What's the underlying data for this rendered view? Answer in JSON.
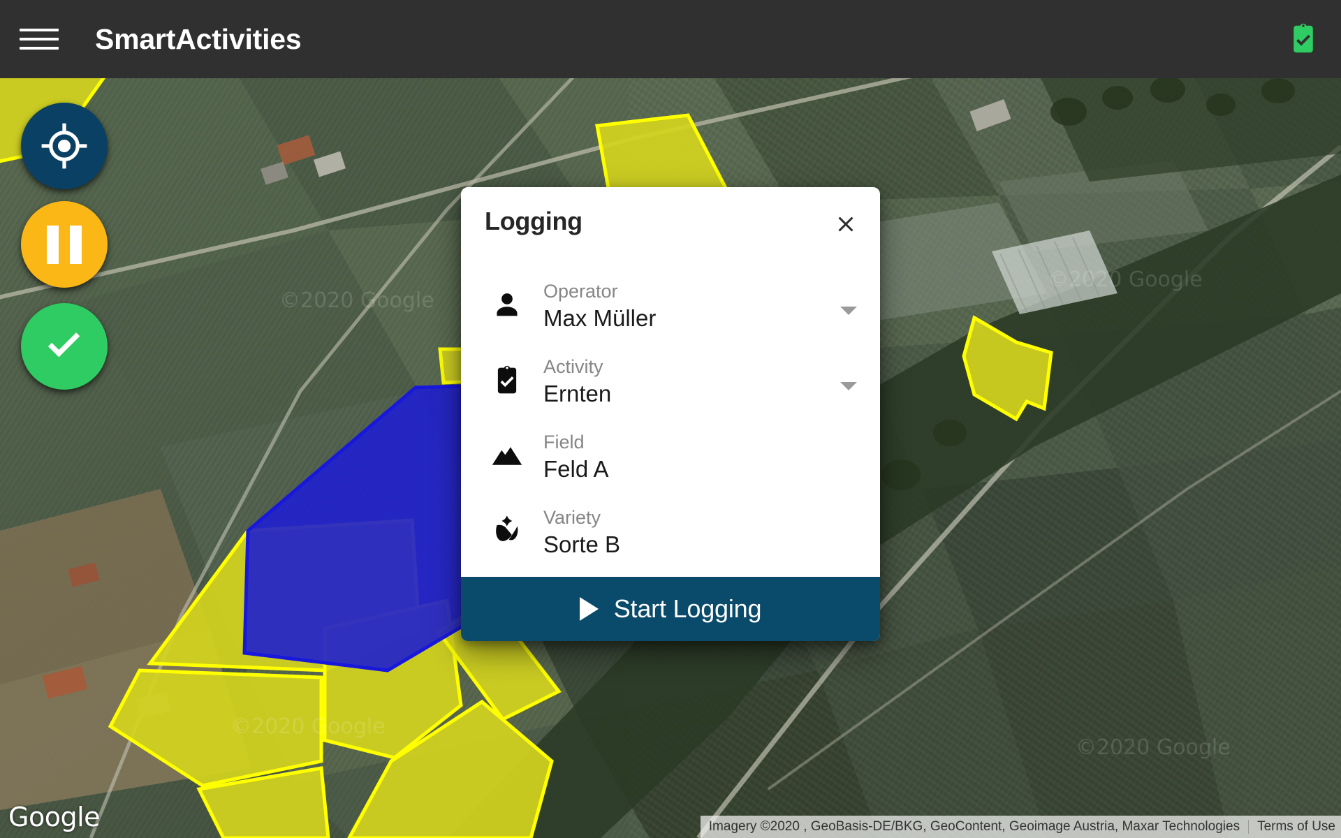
{
  "appbar": {
    "menu_icon": "hamburger-menu-icon",
    "title": "SmartActivities",
    "action_icon": "clipboard-check-icon",
    "action_icon_color": "#2ecc62",
    "background_color": "#303030"
  },
  "map_controls": {
    "locate": {
      "icon": "gps-crosshair-icon",
      "color": "#0a4064"
    },
    "pause": {
      "icon": "pause-icon",
      "color": "#fbb715"
    },
    "confirm": {
      "icon": "check-icon",
      "color": "#2ecc62"
    }
  },
  "dialog": {
    "title": "Logging",
    "close_icon": "close-x-icon",
    "fields": [
      {
        "icon": "person-icon",
        "label": "Operator",
        "value": "Max Müller",
        "has_dropdown": true
      },
      {
        "icon": "clipboard-check-icon",
        "label": "Activity",
        "value": "Ernten",
        "has_dropdown": true
      },
      {
        "icon": "terrain-mountains-icon",
        "label": "Field",
        "value": "Feld A",
        "has_dropdown": false
      },
      {
        "icon": "flower-rose-icon",
        "label": "Variety",
        "value": "Sorte B",
        "has_dropdown": false
      }
    ],
    "primary_button": {
      "label": "Start Logging",
      "icon": "play-icon",
      "color": "#0a4b6b"
    }
  },
  "map": {
    "provider_logo": "Google",
    "attribution": "Imagery ©2020 , GeoBasis-DE/BKG, GeoContent, Geoimage Austria, Maxar Technologies",
    "terms_link": "Terms of Use",
    "watermarks": [
      "©2020 Google",
      "©2020 Google",
      "©2020 Google"
    ],
    "selected_parcel_color": "#2222cc",
    "parcel_outline_color": "#ffff00",
    "parcel_fill_color": "#d4d41e"
  }
}
